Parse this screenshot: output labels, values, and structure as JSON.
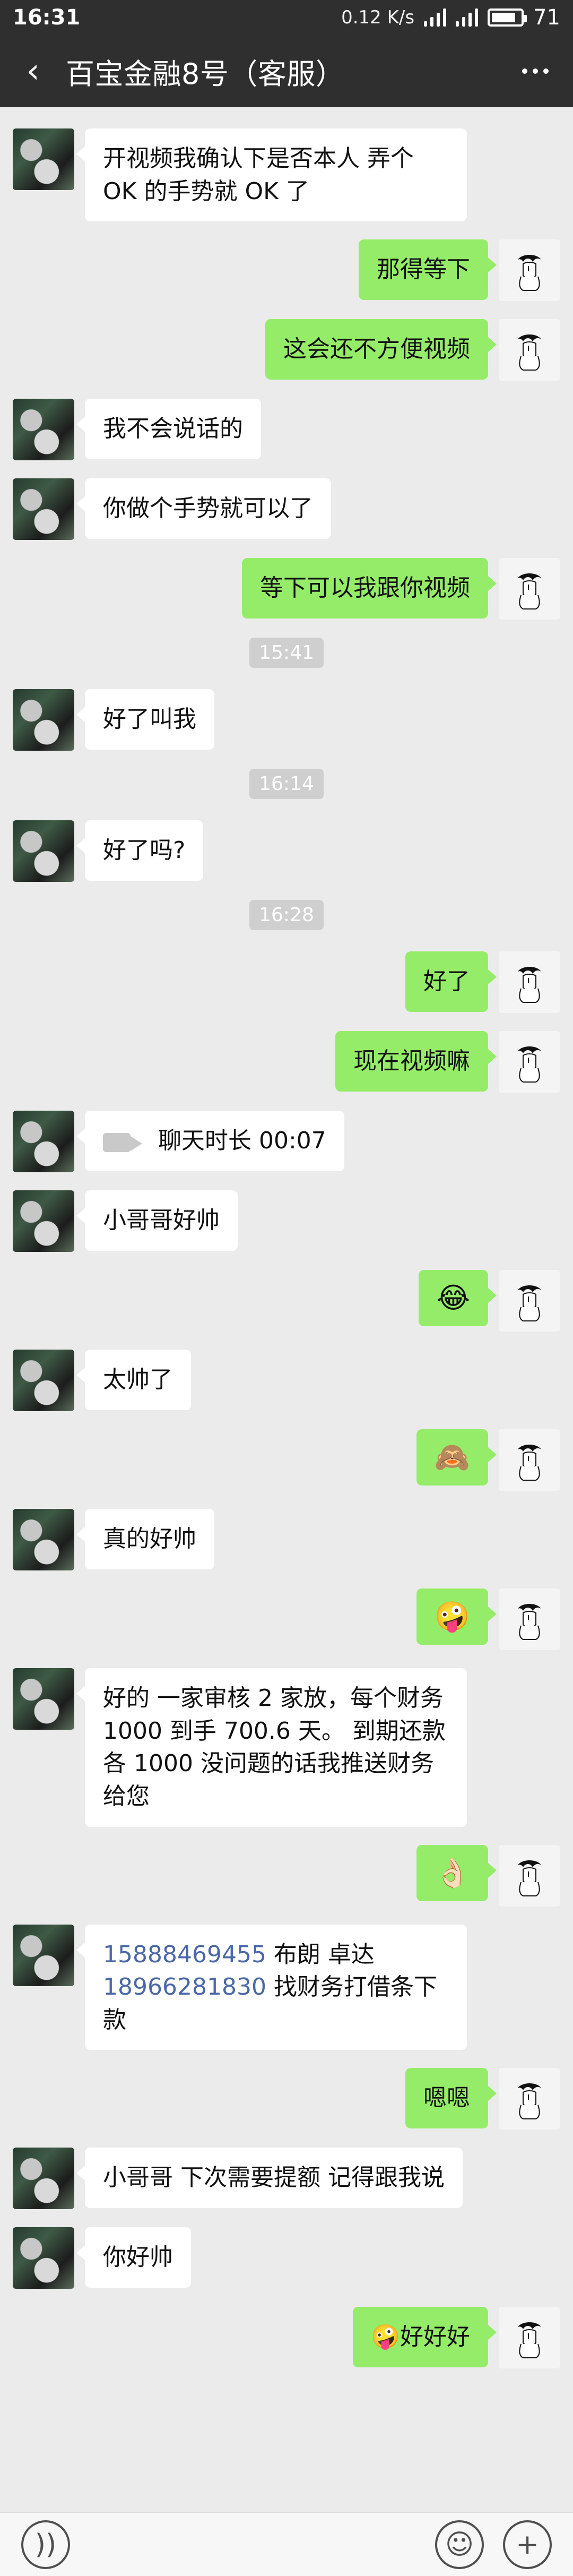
{
  "status": {
    "time": "16:31",
    "net_speed": "0.12 K/s",
    "battery": "71"
  },
  "header": {
    "back_icon": "chevron-left-icon",
    "title": "百宝金融8号（客服）",
    "more_icon": "more-dots-icon"
  },
  "messages": [
    {
      "type": "text",
      "side": "left",
      "text": "开视频我确认下是否本人  弄个 OK 的手势就 OK 了"
    },
    {
      "type": "text",
      "side": "right",
      "text": "那得等下"
    },
    {
      "type": "text",
      "side": "right",
      "text": "这会还不方便视频"
    },
    {
      "type": "text",
      "side": "left",
      "text": "我不会说话的"
    },
    {
      "type": "text",
      "side": "left",
      "text": "你做个手势就可以了"
    },
    {
      "type": "text",
      "side": "right",
      "text": "等下可以我跟你视频"
    },
    {
      "type": "time",
      "text": "15:41"
    },
    {
      "type": "text",
      "side": "left",
      "text": "好了叫我"
    },
    {
      "type": "time",
      "text": "16:14"
    },
    {
      "type": "text",
      "side": "left",
      "text": "好了吗?"
    },
    {
      "type": "time",
      "text": "16:28"
    },
    {
      "type": "text",
      "side": "right",
      "text": "好了"
    },
    {
      "type": "text",
      "side": "right",
      "text": "现在视频嘛"
    },
    {
      "type": "call",
      "side": "left",
      "text": "聊天时长 00:07"
    },
    {
      "type": "text",
      "side": "left",
      "text": "小哥哥好帅"
    },
    {
      "type": "emoji",
      "side": "right",
      "text": "😂"
    },
    {
      "type": "text",
      "side": "left",
      "text": "太帅了"
    },
    {
      "type": "emoji",
      "side": "right",
      "text": "🙈"
    },
    {
      "type": "text",
      "side": "left",
      "text": "真的好帅"
    },
    {
      "type": "emoji",
      "side": "right",
      "text": "🤪"
    },
    {
      "type": "text",
      "side": "left",
      "text": "好的 一家审核 2 家放，每个财务 1000 到手 700.6 天。 到期还款各 1000  没问题的话我推送财务给您"
    },
    {
      "type": "emoji",
      "side": "right",
      "text": "👌🏻"
    },
    {
      "type": "phones",
      "side": "left",
      "lines": [
        "15888469455 布朗     卓达",
        "18966281830  找财务打借条下款"
      ]
    },
    {
      "type": "text",
      "side": "right",
      "text": "嗯嗯"
    },
    {
      "type": "text",
      "side": "left",
      "text": "小哥哥 下次需要提额 记得跟我说"
    },
    {
      "type": "text",
      "side": "left",
      "text": "你好帅"
    },
    {
      "type": "text",
      "side": "right",
      "text": "🤪好好好"
    }
  ],
  "bottom": {
    "voice_icon": "voice-icon",
    "emoji_icon": "emoji-icon",
    "plus_icon": "plus-icon"
  }
}
